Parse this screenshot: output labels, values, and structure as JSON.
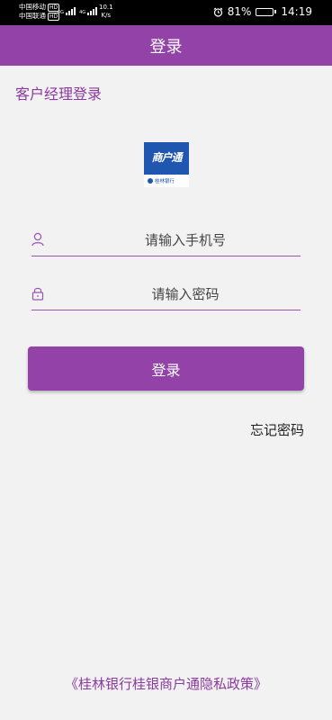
{
  "status_bar": {
    "carrier_1": "中国移动",
    "carrier_2": "中国联通",
    "hd_badge": "HD",
    "signal_label": "4G",
    "net_speed_value": "10.1",
    "net_speed_unit": "K/s",
    "battery_percent": "81%",
    "battery_level": 0.81,
    "time": "14:19"
  },
  "app_bar": {
    "title": "登录"
  },
  "section_title": "客户经理登录",
  "logo": {
    "product_name": "商户通",
    "bank_name": "桂林银行"
  },
  "form": {
    "phone_placeholder": "请输入手机号",
    "password_placeholder": "请输入密码",
    "login_label": "登录",
    "forgot_password": "忘记密码"
  },
  "privacy_policy": "《桂林银行桂银商户通隐私政策》",
  "colors": {
    "primary": "#9343a8",
    "primary_text": "#8a3a9e",
    "logo_blue": "#1f56b0"
  }
}
